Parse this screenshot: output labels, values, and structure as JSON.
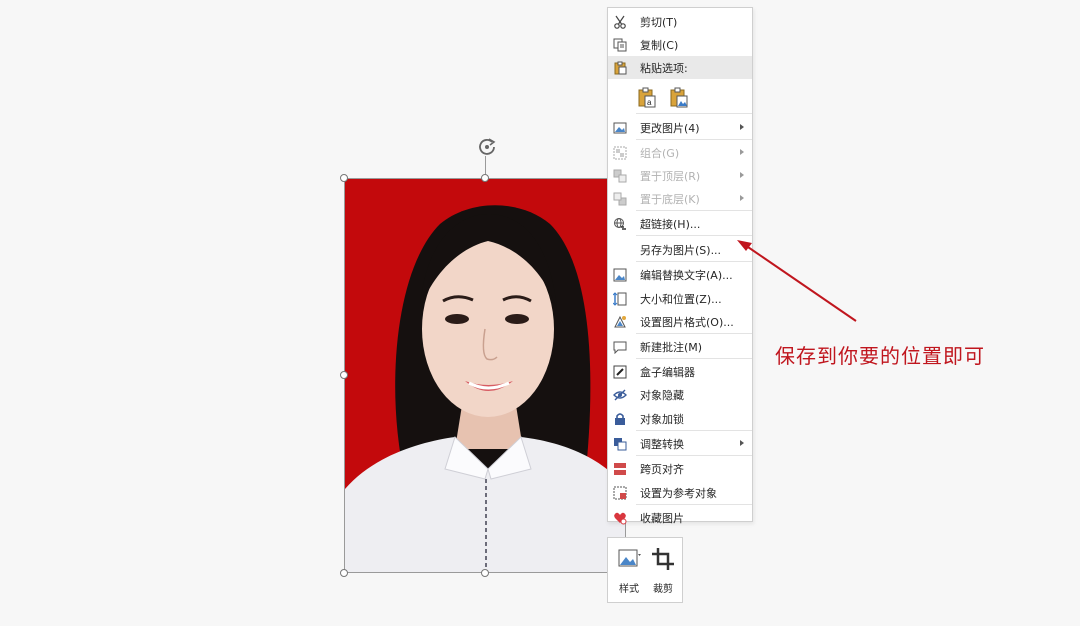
{
  "context_menu": {
    "items": [
      {
        "label": "剪切(T)",
        "icon": "scissors-icon",
        "disabled": false,
        "submenu": false
      },
      {
        "label": "复制(C)",
        "icon": "copy-icon",
        "disabled": false,
        "submenu": false
      },
      {
        "label": "粘贴选项:",
        "icon": "clipboard-icon",
        "disabled": false,
        "submenu": false,
        "header": true
      },
      {
        "label": "更改图片(4)",
        "icon": "change-picture-icon",
        "disabled": false,
        "submenu": true
      },
      {
        "label": "组合(G)",
        "icon": "group-icon",
        "disabled": true,
        "submenu": true
      },
      {
        "label": "置于顶层(R)",
        "icon": "bring-to-front-icon",
        "disabled": true,
        "submenu": true
      },
      {
        "label": "置于底层(K)",
        "icon": "send-to-back-icon",
        "disabled": true,
        "submenu": true
      },
      {
        "label": "超链接(H)...",
        "icon": "hyperlink-icon",
        "disabled": false,
        "submenu": false
      },
      {
        "label": "另存为图片(S)...",
        "icon": "",
        "disabled": false,
        "submenu": false
      },
      {
        "label": "编辑替换文字(A)...",
        "icon": "alt-text-icon",
        "disabled": false,
        "submenu": false
      },
      {
        "label": "大小和位置(Z)...",
        "icon": "size-position-icon",
        "disabled": false,
        "submenu": false
      },
      {
        "label": "设置图片格式(O)...",
        "icon": "format-picture-icon",
        "disabled": false,
        "submenu": false
      },
      {
        "label": "新建批注(M)",
        "icon": "new-comment-icon",
        "disabled": false,
        "submenu": false
      },
      {
        "label": "盒子编辑器",
        "icon": "box-editor-icon",
        "disabled": false,
        "submenu": false
      },
      {
        "label": "对象隐藏",
        "icon": "hide-eye-icon",
        "disabled": false,
        "submenu": false
      },
      {
        "label": "对象加锁",
        "icon": "lock-icon",
        "disabled": false,
        "submenu": false
      },
      {
        "label": "调整转换",
        "icon": "adjust-convert-icon",
        "disabled": false,
        "submenu": true
      },
      {
        "label": "跨页对齐",
        "icon": "cross-page-align-icon",
        "disabled": false,
        "submenu": false
      },
      {
        "label": "设置为参考对象",
        "icon": "reference-object-icon",
        "disabled": false,
        "submenu": false
      },
      {
        "label": "收藏图片",
        "icon": "favorite-heart-icon",
        "disabled": false,
        "submenu": false
      }
    ],
    "paste_options": [
      {
        "icon": "paste-keep-text-icon"
      },
      {
        "icon": "paste-picture-icon"
      }
    ]
  },
  "mini_toolbar": {
    "style_label": "样式",
    "crop_label": "裁剪"
  },
  "annotation": {
    "text": "保存到你要的位置即可",
    "color": "#c0161e"
  },
  "photo": {
    "background_color": "#c3090c"
  }
}
